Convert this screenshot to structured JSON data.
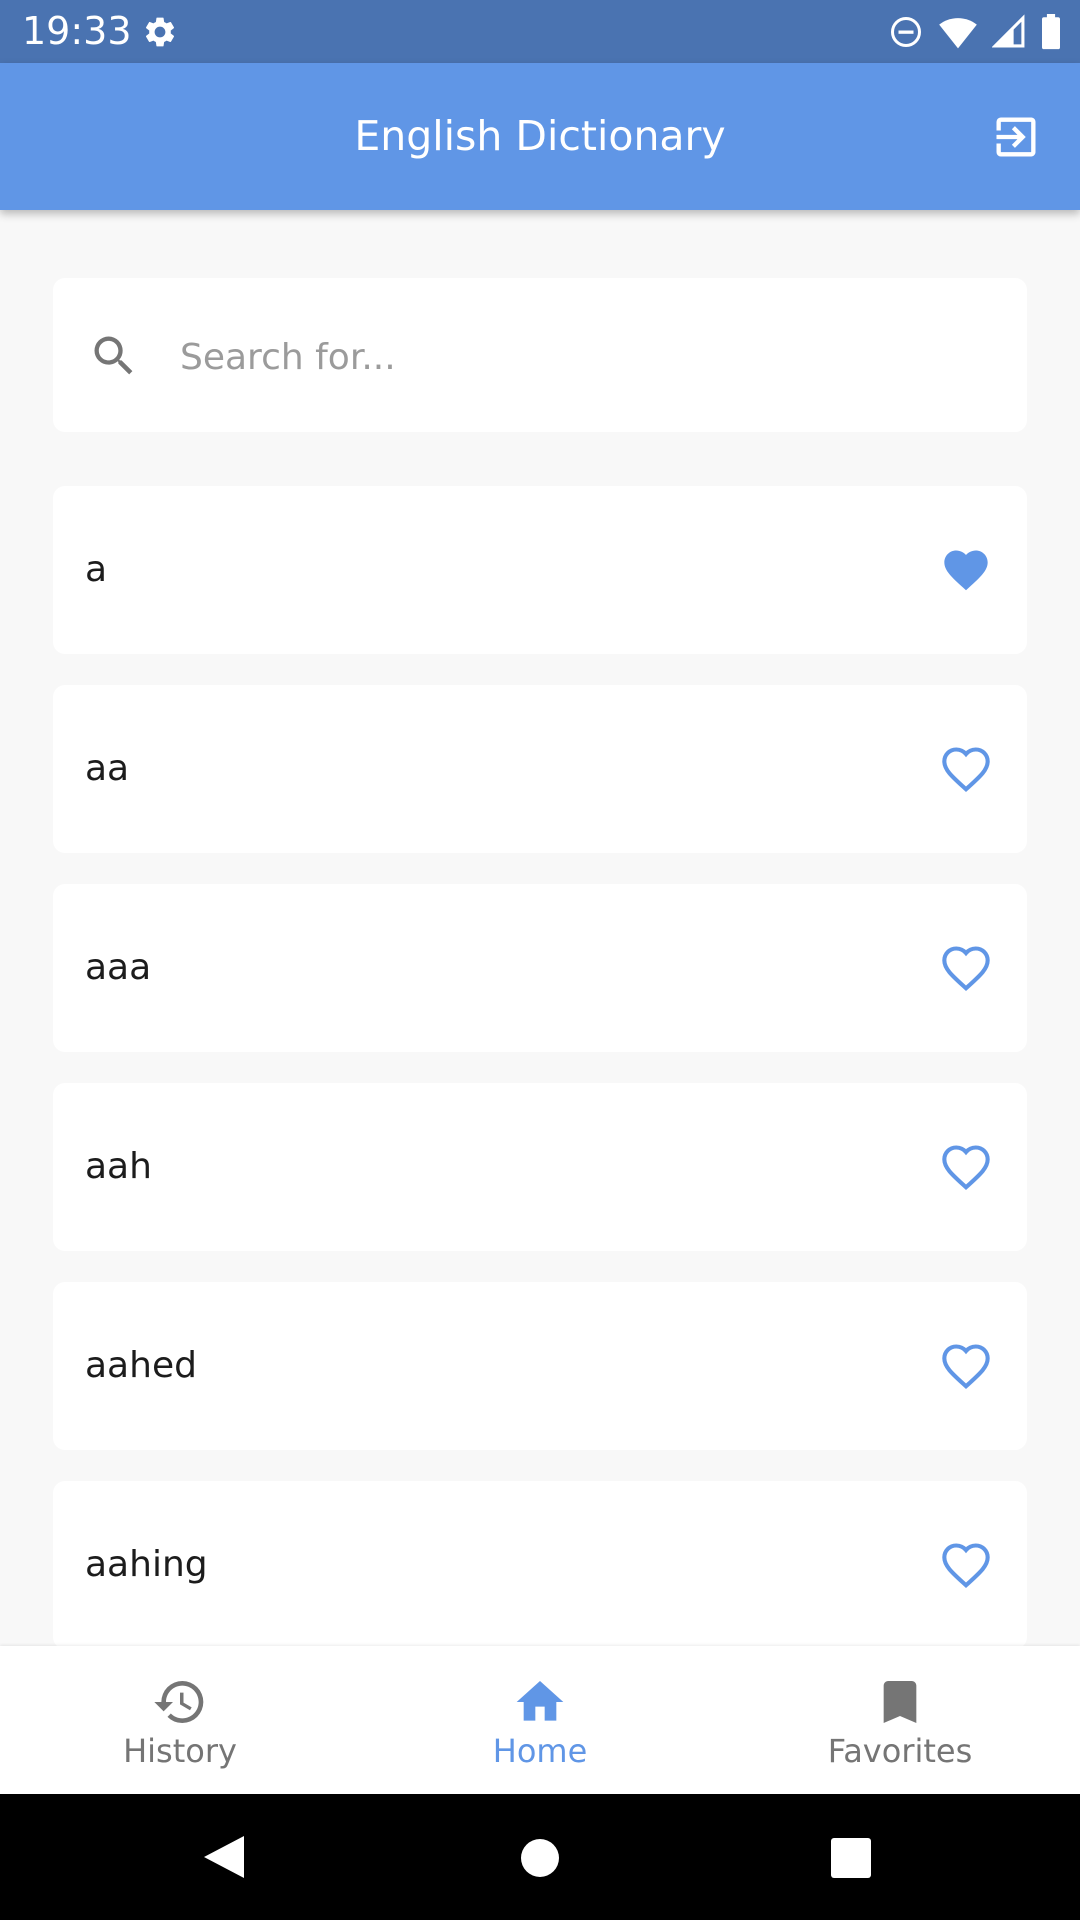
{
  "status_bar": {
    "time": "19:33"
  },
  "app_bar": {
    "title": "English Dictionary"
  },
  "search": {
    "placeholder": "Search for..."
  },
  "words": [
    {
      "word": "a",
      "favorite": true
    },
    {
      "word": "aa",
      "favorite": false
    },
    {
      "word": "aaa",
      "favorite": false
    },
    {
      "word": "aah",
      "favorite": false
    },
    {
      "word": "aahed",
      "favorite": false
    },
    {
      "word": "aahing",
      "favorite": false
    }
  ],
  "bottom_nav": {
    "items": [
      {
        "label": "History",
        "active": false
      },
      {
        "label": "Home",
        "active": true
      },
      {
        "label": "Favorites",
        "active": false
      }
    ]
  },
  "colors": {
    "status_bar": "#4a73b1",
    "app_bar": "#6096e6",
    "accent": "#6096e6",
    "inactive": "#757575",
    "background": "#f8f8f8"
  },
  "icons": {
    "status": [
      "gear-icon",
      "dnd-icon",
      "wifi-icon",
      "signal-icon",
      "battery-icon"
    ],
    "app_bar": "logout-icon",
    "search": "search-icon",
    "favorite_on": "heart-filled-icon",
    "favorite_off": "heart-outline-icon",
    "nav": [
      "history-icon",
      "home-icon",
      "bookmark-icon"
    ],
    "system": [
      "back-icon",
      "home-circle-icon",
      "recents-icon"
    ]
  }
}
